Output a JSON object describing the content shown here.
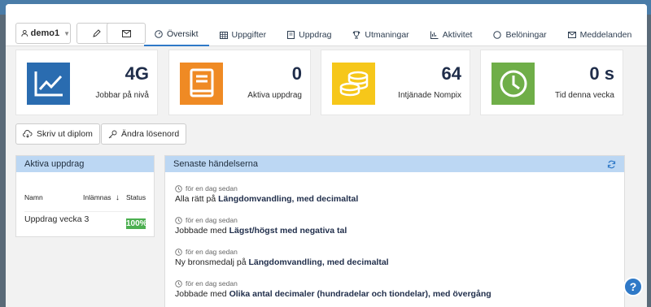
{
  "header": {
    "username": "demo1",
    "tabs": [
      {
        "label": "Översikt",
        "icon": "gauge-icon",
        "active": true
      },
      {
        "label": "Uppgifter",
        "icon": "table-icon",
        "active": false
      },
      {
        "label": "Uppdrag",
        "icon": "book-icon",
        "active": false
      },
      {
        "label": "Utmaningar",
        "icon": "trophy-icon",
        "active": false
      },
      {
        "label": "Aktivitet",
        "icon": "chart-icon",
        "active": false
      },
      {
        "label": "Belöningar",
        "icon": "circle-icon",
        "active": false
      },
      {
        "label": "Meddelanden",
        "icon": "envelope-icon",
        "active": false
      }
    ]
  },
  "stats": [
    {
      "value": "4G",
      "label": "Jobbar på nivå",
      "color": "#2a6cb0",
      "icon": "line-chart-icon"
    },
    {
      "value": "0",
      "label": "Aktiva uppdrag",
      "color": "#ef8a24",
      "icon": "book-icon"
    },
    {
      "value": "64",
      "label": "Intjänade Nompix",
      "color": "#f6c71a",
      "icon": "coins-icon"
    },
    {
      "value": "0 s",
      "label": "Tid denna vecka",
      "color": "#6fae48",
      "icon": "clock-icon"
    }
  ],
  "actions": {
    "diploma": "Skriv ut diplom",
    "password": "Ändra lösenord"
  },
  "active_missions": {
    "title": "Aktiva uppdrag",
    "columns": [
      "Namn",
      "Inlämnas",
      "Status"
    ],
    "rows": [
      {
        "name": "Uppdrag vecka 3",
        "status": "100%"
      }
    ]
  },
  "events": {
    "title": "Senaste händelserna",
    "items": [
      {
        "ago": "för en dag sedan",
        "prefix": "Alla rätt på ",
        "bold": "Längdomvandling, med decimaltal"
      },
      {
        "ago": "för en dag sedan",
        "prefix": "Jobbade med ",
        "bold": "Lägst/högst med negativa tal"
      },
      {
        "ago": "för en dag sedan",
        "prefix": "Ny bronsmedalj på ",
        "bold": "Längdomvandling, med decimaltal"
      },
      {
        "ago": "för en dag sedan",
        "prefix": "Jobbade med ",
        "bold": "Olika antal decimaler (hundradelar och tiondelar), med övergång"
      }
    ]
  },
  "help_label": "?"
}
